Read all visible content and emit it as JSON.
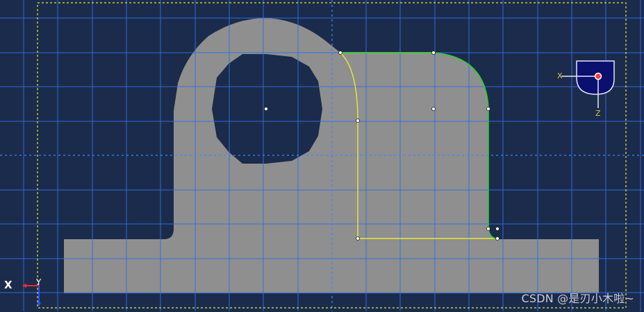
{
  "viewport": {
    "background": "#1b2b4b",
    "grid_color": "#2f6fe0",
    "part_fill": "#8f8f8f",
    "selected_edge_color": "#e8e83a",
    "highlight_edge_color": "#2ad12a",
    "boundary_dash_color": "#e8e83a"
  },
  "view_cube": {
    "icon": "view-orientation-cube-icon",
    "x_label": "X",
    "z_label": "Z",
    "label_color": "#e6c52a",
    "face_color": "#0b0f6e"
  },
  "triad": {
    "icon": "coordinate-triad-icon",
    "x_label": "X",
    "y_label": "Y"
  },
  "watermark": {
    "text": "CSDN @是刃小木啦~"
  }
}
